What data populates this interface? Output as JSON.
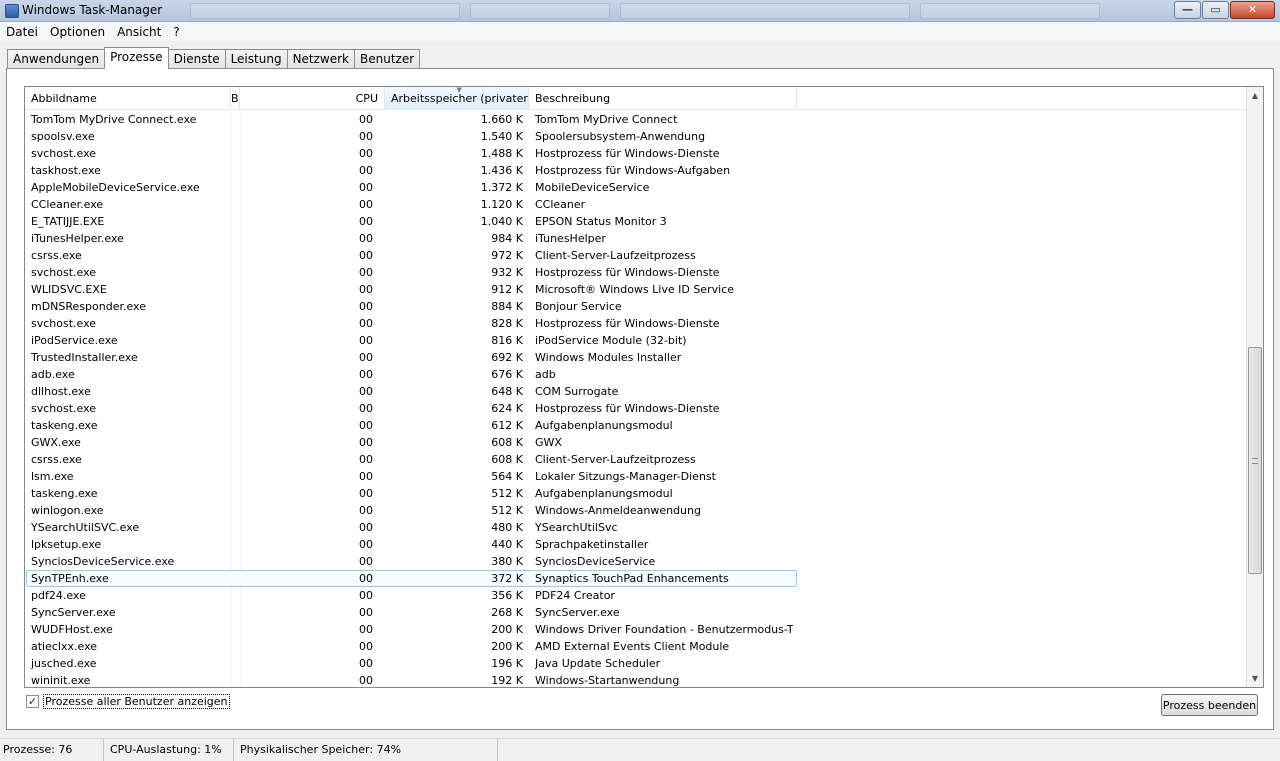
{
  "window": {
    "title": "Windows Task-Manager"
  },
  "menu": [
    "Datei",
    "Optionen",
    "Ansicht",
    "?"
  ],
  "tabs": [
    {
      "label": "Anwendungen",
      "active": false
    },
    {
      "label": "Prozesse",
      "active": true
    },
    {
      "label": "Dienste",
      "active": false
    },
    {
      "label": "Leistung",
      "active": false
    },
    {
      "label": "Netzwerk",
      "active": false
    },
    {
      "label": "Benutzer",
      "active": false
    }
  ],
  "table": {
    "headers": {
      "name": "Abbildname",
      "user": "B",
      "cpu": "CPU",
      "mem": "Arbeitsspeicher (privater ...",
      "desc": "Beschreibung"
    },
    "sorted_column": "mem",
    "highlighted_row": 27,
    "rows": [
      [
        "TomTom MyDrive Connect.exe",
        "00",
        "1.660 K",
        "TomTom MyDrive Connect"
      ],
      [
        "spoolsv.exe",
        "00",
        "1.540 K",
        "Spoolersubsystem-Anwendung"
      ],
      [
        "svchost.exe",
        "00",
        "1.488 K",
        "Hostprozess für Windows-Dienste"
      ],
      [
        "taskhost.exe",
        "00",
        "1.436 K",
        "Hostprozess für Windows-Aufgaben"
      ],
      [
        "AppleMobileDeviceService.exe",
        "00",
        "1.372 K",
        "MobileDeviceService"
      ],
      [
        "CCleaner.exe",
        "00",
        "1.120 K",
        "CCleaner"
      ],
      [
        "E_TATIJJE.EXE",
        "00",
        "1.040 K",
        "EPSON Status Monitor 3"
      ],
      [
        "iTunesHelper.exe",
        "00",
        "984 K",
        "iTunesHelper"
      ],
      [
        "csrss.exe",
        "00",
        "972 K",
        "Client-Server-Laufzeitprozess"
      ],
      [
        "svchost.exe",
        "00",
        "932 K",
        "Hostprozess für Windows-Dienste"
      ],
      [
        "WLIDSVC.EXE",
        "00",
        "912 K",
        "Microsoft® Windows Live ID Service"
      ],
      [
        "mDNSResponder.exe",
        "00",
        "884 K",
        "Bonjour Service"
      ],
      [
        "svchost.exe",
        "00",
        "828 K",
        "Hostprozess für Windows-Dienste"
      ],
      [
        "iPodService.exe",
        "00",
        "816 K",
        "iPodService Module (32-bit)"
      ],
      [
        "TrustedInstaller.exe",
        "00",
        "692 K",
        "Windows Modules Installer"
      ],
      [
        "adb.exe",
        "00",
        "676 K",
        "adb"
      ],
      [
        "dllhost.exe",
        "00",
        "648 K",
        "COM Surrogate"
      ],
      [
        "svchost.exe",
        "00",
        "624 K",
        "Hostprozess für Windows-Dienste"
      ],
      [
        "taskeng.exe",
        "00",
        "612 K",
        "Aufgabenplanungsmodul"
      ],
      [
        "GWX.exe",
        "00",
        "608 K",
        "GWX"
      ],
      [
        "csrss.exe",
        "00",
        "608 K",
        "Client-Server-Laufzeitprozess"
      ],
      [
        "lsm.exe",
        "00",
        "564 K",
        "Lokaler Sitzungs-Manager-Dienst"
      ],
      [
        "taskeng.exe",
        "00",
        "512 K",
        "Aufgabenplanungsmodul"
      ],
      [
        "winlogon.exe",
        "00",
        "512 K",
        "Windows-Anmeldeanwendung"
      ],
      [
        "YSearchUtilSVC.exe",
        "00",
        "480 K",
        "YSearchUtilSvc"
      ],
      [
        "lpksetup.exe",
        "00",
        "440 K",
        "Sprachpaketinstaller"
      ],
      [
        "SynciosDeviceService.exe",
        "00",
        "380 K",
        "SynciosDeviceService"
      ],
      [
        "SynTPEnh.exe",
        "00",
        "372 K",
        "Synaptics TouchPad Enhancements"
      ],
      [
        "pdf24.exe",
        "00",
        "356 K",
        "PDF24 Creator"
      ],
      [
        "SyncServer.exe",
        "00",
        "268 K",
        "SyncServer.exe"
      ],
      [
        "WUDFHost.exe",
        "00",
        "200 K",
        "Windows Driver Foundation - Benutzermodus-Trei..."
      ],
      [
        "atieclxx.exe",
        "00",
        "200 K",
        "AMD External Events Client Module"
      ],
      [
        "jusched.exe",
        "00",
        "196 K",
        "Java Update Scheduler"
      ],
      [
        "wininit.exe",
        "00",
        "192 K",
        "Windows-Startanwendung"
      ]
    ]
  },
  "checkbox": {
    "label": "Prozesse aller Benutzer anzeigen",
    "checked": true
  },
  "end_button": {
    "label": "Prozess beenden"
  },
  "status": {
    "processes": "Prozesse: 76",
    "cpu": "CPU-Auslastung: 1%",
    "memory": "Physikalischer Speicher: 74%"
  },
  "scrollbar": {
    "thumb_start": 0.43,
    "thumb_end": 0.83
  }
}
